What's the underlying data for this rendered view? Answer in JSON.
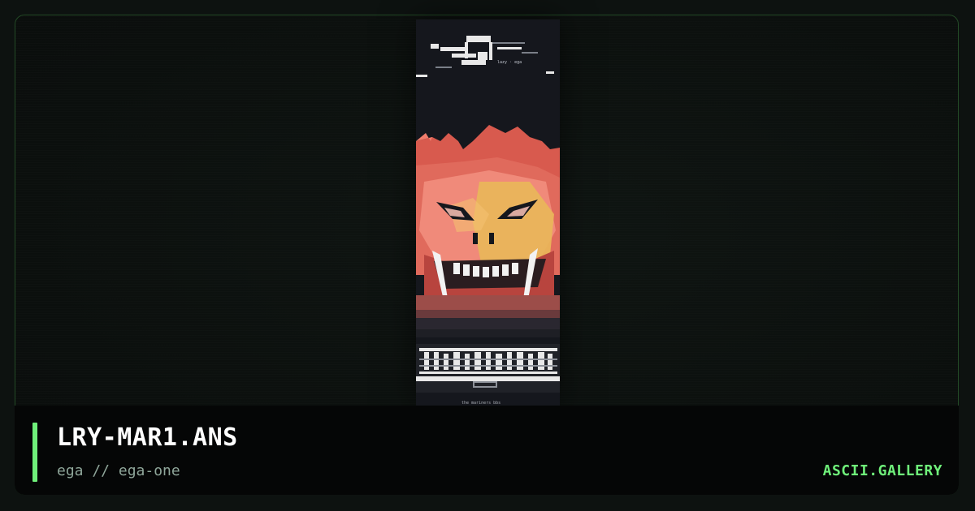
{
  "artwork": {
    "filename": "LRY-MAR1.ANS",
    "palette_line": "ega // ega-one",
    "tiny_caption_top": "lazy · ega",
    "tiny_caption_bottom": "the mariners bbs"
  },
  "site": {
    "brand": "ASCII.GALLERY"
  },
  "colors": {
    "accent": "#6ff07a",
    "subtitle": "#8fa69a",
    "frame_border": "#234a26",
    "art_bg": "#15171d",
    "creature_red": "#e06a5c",
    "creature_pink": "#f08a7a",
    "creature_yellow": "#e9b659"
  }
}
